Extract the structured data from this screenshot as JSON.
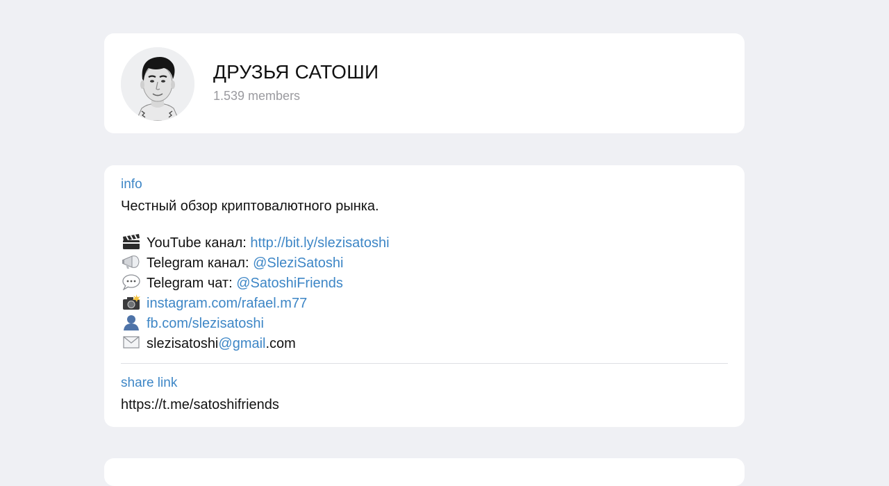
{
  "group": {
    "title": "ДРУЗЬЯ САТОШИ",
    "members": "1.539 members"
  },
  "info": {
    "label": "info",
    "description": "Честный обзор криптовалютного рынка.",
    "lines": [
      {
        "icon": "clapperboard-icon",
        "prefix": "YouTube канал: ",
        "link": "http://bit.ly/slezisatoshi",
        "suffix": ""
      },
      {
        "icon": "megaphone-icon",
        "prefix": "Telegram канал: ",
        "link": "@SleziSatoshi",
        "suffix": ""
      },
      {
        "icon": "speech-bubble-icon",
        "prefix": "Telegram чат: ",
        "link": "@SatoshiFriends",
        "suffix": ""
      },
      {
        "icon": "camera-flash-icon",
        "prefix": "",
        "link": "instagram.com/rafael.m77",
        "suffix": ""
      },
      {
        "icon": "user-silhouette-icon",
        "prefix": "",
        "link": "fb.com/slezisatoshi",
        "suffix": ""
      },
      {
        "icon": "envelope-icon",
        "prefix": "slezisatoshi",
        "link": "@gmail",
        "suffix": ".com"
      }
    ]
  },
  "share": {
    "label": "share link",
    "value": "https://t.me/satoshifriends"
  },
  "colors": {
    "background": "#eff0f4",
    "card": "#ffffff",
    "link": "#3d86c6",
    "muted": "#9a9a9f"
  }
}
